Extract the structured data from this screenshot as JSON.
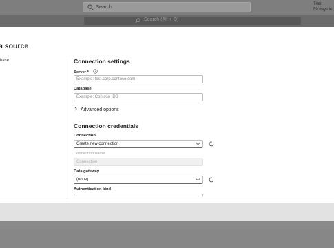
{
  "top": {
    "search_placeholder": "Search",
    "trial_line1": "Trial:",
    "trial_line2": "59 days le"
  },
  "command_bar": {
    "search_text": "Search (Alt + Q)"
  },
  "dialog": {
    "title": "a source",
    "nav_item": "base",
    "connection_settings": {
      "heading": "Connection settings",
      "server_label": "Server *",
      "server_placeholder": "Example: test.corp.contoso.com",
      "database_label": "Database",
      "database_placeholder": "Example: Contoso_DB",
      "advanced_options": "Advanced options"
    },
    "connection_credentials": {
      "heading": "Connection credentials",
      "connection_label": "Connection",
      "connection_value": "Create new connection",
      "connection_name_label": "Connection name",
      "connection_name_value": "Connection",
      "data_gateway_label": "Data gateway",
      "data_gateway_value": "(none)",
      "auth_kind_label": "Authentication kind"
    }
  },
  "colors": {
    "accent": "#0f6cbd",
    "overlay": "#8a8a8a"
  }
}
